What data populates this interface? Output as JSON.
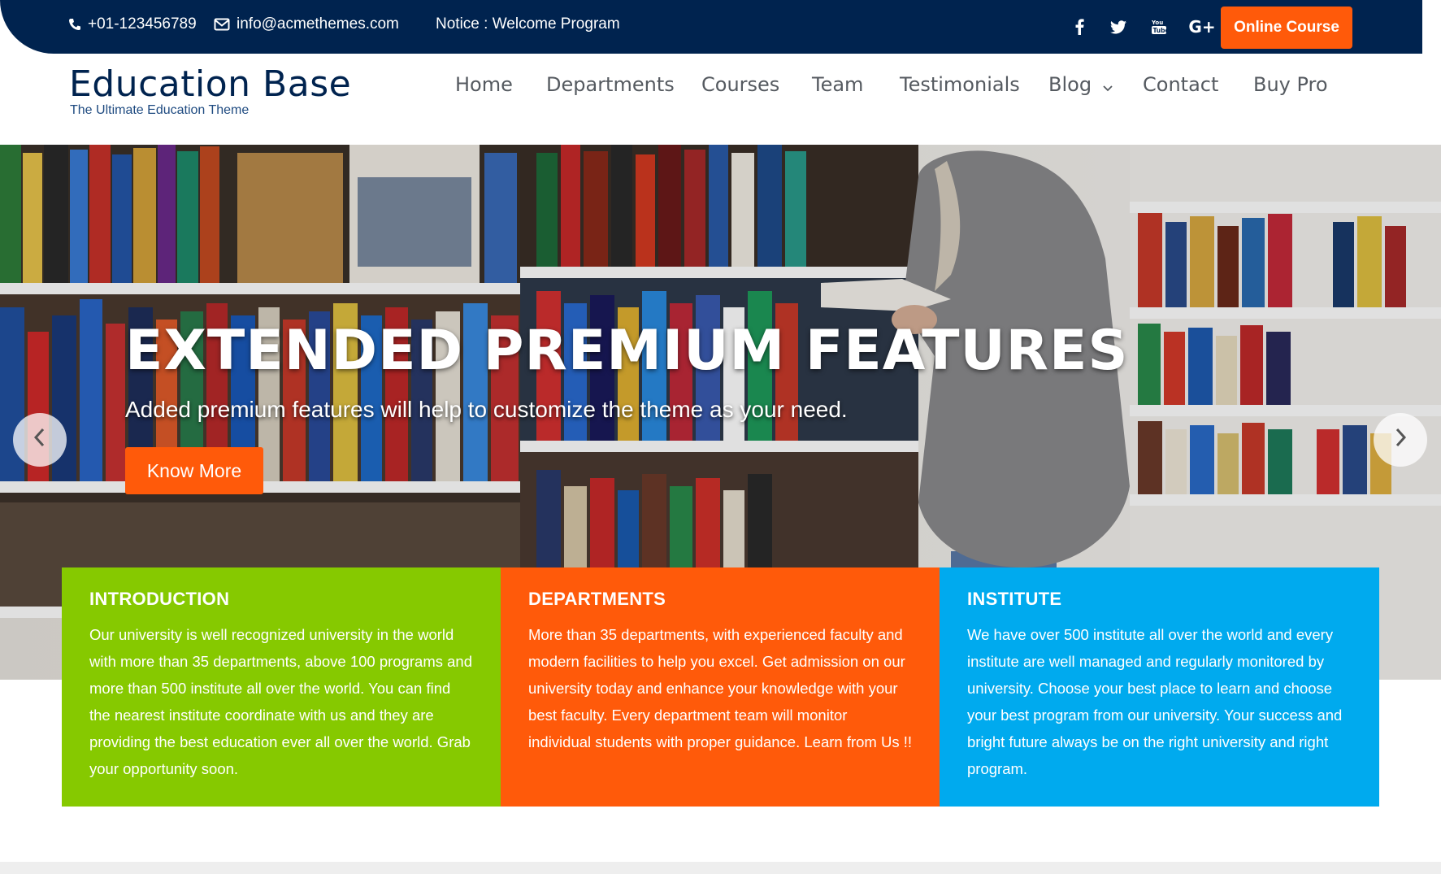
{
  "topbar": {
    "phone": "+01-123456789",
    "email": "info@acmethemes.com",
    "notice": "Notice : Welcome Program",
    "social": [
      "facebook-icon",
      "twitter-icon",
      "youtube-icon",
      "google-plus-icon"
    ],
    "cta_label": "Online Course",
    "bg_color": "#00234f",
    "accent_color": "#ff5a0a"
  },
  "brand": {
    "title": "Education Base",
    "tagline": "The Ultimate Education Theme"
  },
  "nav": {
    "items": [
      "Home",
      "Departments",
      "Courses",
      "Team",
      "Testimonials",
      "Blog",
      "Contact",
      "Buy Pro"
    ]
  },
  "hero": {
    "title": "EXTENDED PREMIUM FEATURES",
    "subtitle": "Added premium features will help to customize the theme as your need.",
    "button_label": "Know More"
  },
  "boxes": [
    {
      "title": "INTRODUCTION",
      "text": "Our university is well recognized university in the world with more than 35 departments, above 100 programs and more than 500 institute all over the world. You can find the nearest institute coordinate with us and they are providing the best education ever all over the world. Grab your opportunity soon.",
      "color": "#86c900"
    },
    {
      "title": "DEPARTMENTS",
      "text": "More than 35 departments, with experienced faculty and modern facilities to help you excel. Get admission on our university today and enhance your knowledge with your best faculty. Every department team will monitor individual students with proper guidance. Learn from Us !!",
      "color": "#ff5a0a"
    },
    {
      "title": "INSTITUTE",
      "text": "We have over 500 institute all over the world and every institute are well managed and regularly monitored by university. Choose your best place to learn and choose your best program from our university. Your success and bright future always be on the right university and right program.",
      "color": "#00aaee"
    }
  ]
}
